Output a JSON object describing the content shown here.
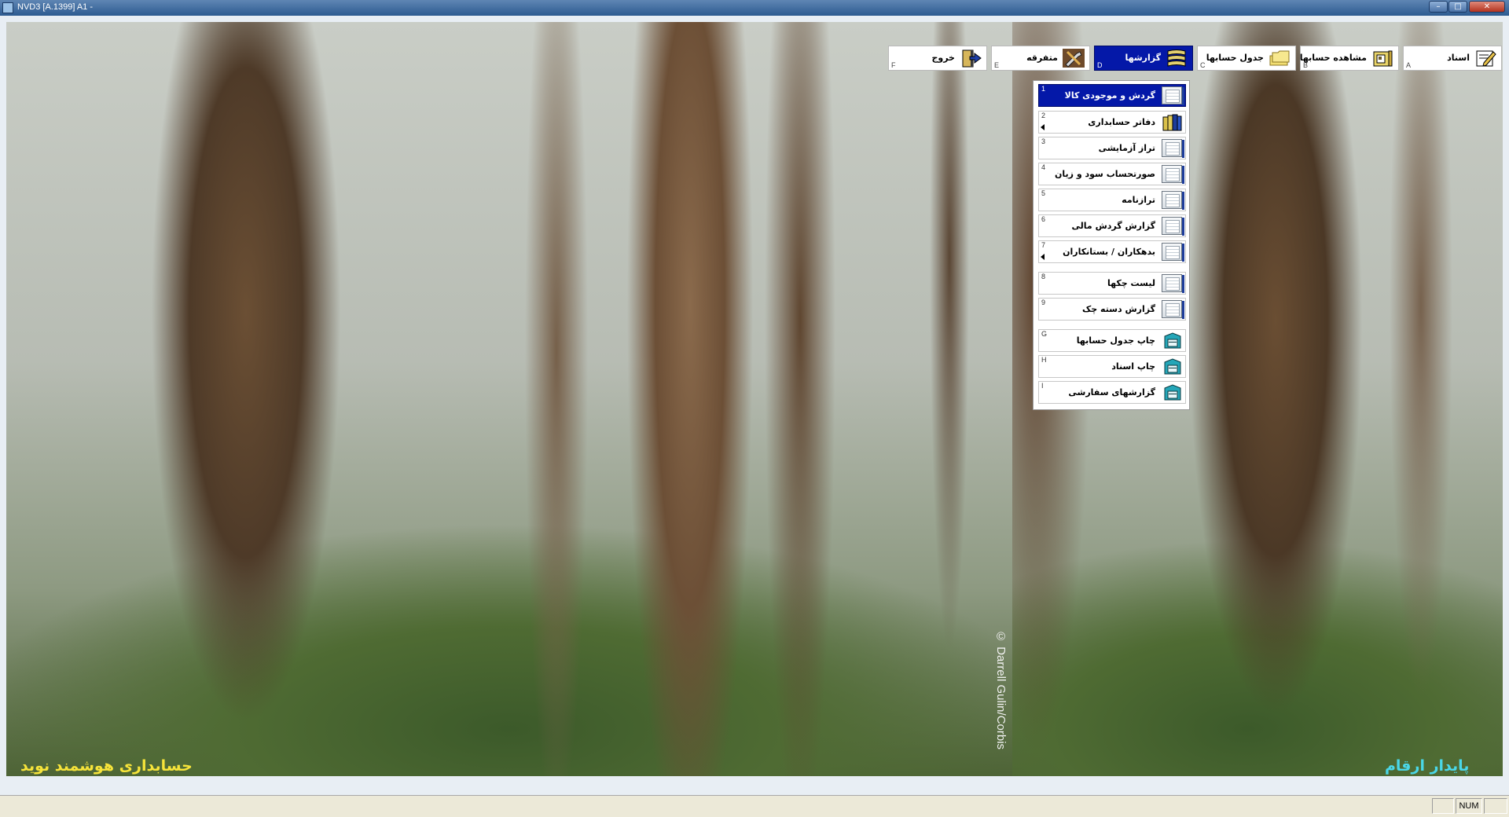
{
  "window": {
    "title": "NVD3 [A.1399] A1 -",
    "min": "–",
    "max": "□",
    "close": "✕"
  },
  "toolbar": {
    "buttons": [
      {
        "label": "اسناد",
        "key": "A",
        "icon": "document-edit-icon"
      },
      {
        "label": "مشاهده حسابها",
        "key": "B",
        "icon": "folder-view-icon"
      },
      {
        "label": "جدول حسابها",
        "key": "C",
        "icon": "folders-icon"
      },
      {
        "label": "گزارشها",
        "key": "D",
        "icon": "reports-icon",
        "active": true
      },
      {
        "label": "متفرقه",
        "key": "E",
        "icon": "tools-icon"
      },
      {
        "label": "خروج",
        "key": "F",
        "icon": "exit-door-icon"
      }
    ]
  },
  "reports_menu": {
    "items": [
      {
        "key": "1",
        "label": "گردش و موجودی کالا",
        "icon": "report-sheet-icon",
        "active": true
      },
      {
        "key": "2",
        "label": "دفاتر حسابداری",
        "icon": "ledger-books-icon",
        "submenu": true
      },
      {
        "key": "3",
        "label": "تراز آزمایشی",
        "icon": "report-sheet-icon"
      },
      {
        "key": "4",
        "label": "صورتحساب سود و زیان",
        "icon": "report-sheet-icon"
      },
      {
        "key": "5",
        "label": "ترازنامه",
        "icon": "report-sheet-icon"
      },
      {
        "key": "6",
        "label": "گزارش گردش مالی",
        "icon": "report-sheet-icon"
      },
      {
        "key": "7",
        "label": "بدهکاران / بستانکاران",
        "icon": "report-sheet-icon",
        "submenu": true
      },
      {
        "key": "8",
        "label": "لیست چکها",
        "icon": "report-sheet-icon"
      },
      {
        "key": "9",
        "label": "گزارش دسته چک",
        "icon": "report-sheet-icon"
      },
      {
        "key": "G",
        "label": "چاپ جدول حسابها",
        "icon": "print-icon"
      },
      {
        "key": "H",
        "label": "چاپ اسناد",
        "icon": "print-icon"
      },
      {
        "key": "I",
        "label": "گزارشهای سفارشی",
        "icon": "print-icon"
      }
    ]
  },
  "background": {
    "credit": "© Darrell Gulin/Corbis",
    "brand_left": "حسابداری هوشمند نوید",
    "brand_right": "پایدار ارقام"
  },
  "statusbar": {
    "num": "NUM"
  },
  "colors": {
    "active_blue": "#0418a8",
    "brand_left": "#f7e43a",
    "brand_right": "#4ad7e8"
  }
}
